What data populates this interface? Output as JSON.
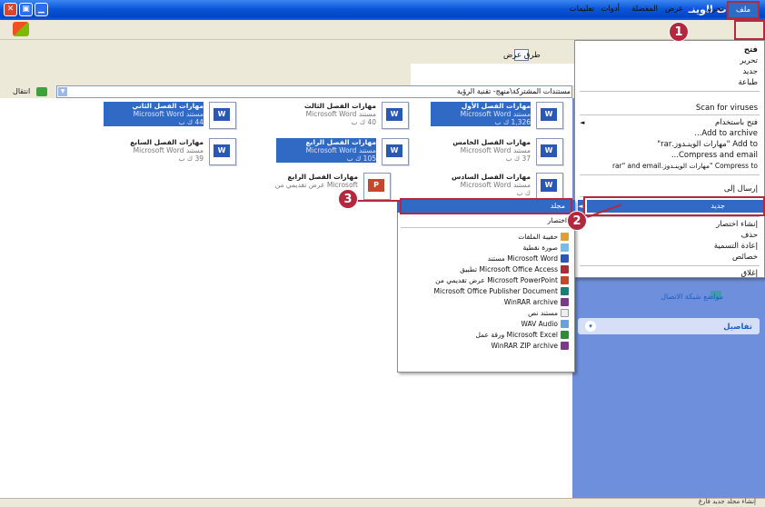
{
  "window": {
    "title": "مهارات الوينـ",
    "controls": {
      "close": "✕",
      "maximize": "▣",
      "minimize": "▁"
    }
  },
  "menubar": {
    "file": "ملف",
    "edit": "تحرير",
    "view": "عرض",
    "favorites": "المفضلة",
    "tools": "أدوات",
    "help": "تعليمات"
  },
  "toolbar": {
    "views": "طرق عرض"
  },
  "address": {
    "go": "انتقال",
    "path": "مستندات المشتركة\\منهج- تقنية الرؤية"
  },
  "files": [
    {
      "name": "مهارات الفصل الأول",
      "sub1": "مستند Microsoft Word",
      "sub2": "1,326 ك ب",
      "selected": true,
      "type": "word"
    },
    {
      "name": "مهارات الفصل الثالث",
      "sub1": "مستند Microsoft Word",
      "sub2": "40 ك ب",
      "selected": false,
      "type": "word"
    },
    {
      "name": "مهارات الفصل الثاني",
      "sub1": "مستند Microsoft Word",
      "sub2": "44 ك ب",
      "selected": true,
      "type": "word"
    },
    {
      "name": "مهارات الفصل الخامس",
      "sub1": "مستند Microsoft Word",
      "sub2": "37 ك ب",
      "selected": false,
      "type": "word"
    },
    {
      "name": "مهارات الفصل الرابع",
      "sub1": "مستند Microsoft Word",
      "sub2": "105 ك ب",
      "selected": true,
      "type": "word"
    },
    {
      "name": "مهارات الفصل السابع",
      "sub1": "مستند Microsoft Word",
      "sub2": "39 ك ب",
      "selected": false,
      "type": "word"
    },
    {
      "name": "مهارات الفصل السادس",
      "sub1": "مستند Microsoft Word",
      "sub2": "ك ب",
      "selected": false,
      "type": "word"
    },
    {
      "name": "مهارات الفصل الرابع",
      "sub1": "Microsoft عرض تقديمي من",
      "sub2": "",
      "selected": false,
      "type": "ppt"
    }
  ],
  "filemenu": {
    "open": "فتح",
    "edit": "تحرير",
    "new": "جديد",
    "print": "طباعة",
    "scan": "Scan for viruses",
    "open_with": "فتح باستخدام",
    "add_archive": "Add to archive...",
    "add_rar": "Add to \"مهارات الوينـدوز.rar\"",
    "compress_email": "Compress and email...",
    "compress_rar_email": "Compress to \"مهارات الوينـدوز.rar\" and email",
    "send_to": "إرسال إلى",
    "new_sub": "جديد",
    "create_shortcut": "إنشاء اختصار",
    "delete": "حذف",
    "rename": "إعادة التسمية",
    "properties": "خصائص",
    "close": "إغلاق"
  },
  "submenu": {
    "folder": "مجلد",
    "shortcut": "اختصار",
    "items": [
      "حقيبة الملفات",
      "صورة نقطية",
      "Microsoft Word مستند",
      "Microsoft Office Access تطبيق",
      "Microsoft PowerPoint عرض تقديمي من",
      "Microsoft Office Publisher Document",
      "WinRAR archive",
      "مستند نص",
      "WAV Audio",
      "Microsoft Excel ورقة عمل",
      "WinRAR ZIP archive"
    ]
  },
  "taskpane": {
    "network": "مواضع شبكة الاتصال",
    "details": "تفاصيل"
  },
  "status": {
    "text": "إنشاء مجلد جديد فارغ"
  },
  "steps": [
    "1",
    "2",
    "3"
  ],
  "colors": {
    "titlebar": "#0a55d8",
    "selection": "#316ac5",
    "taskpane": "#6e8fdc",
    "annotation": "#b4283f"
  }
}
